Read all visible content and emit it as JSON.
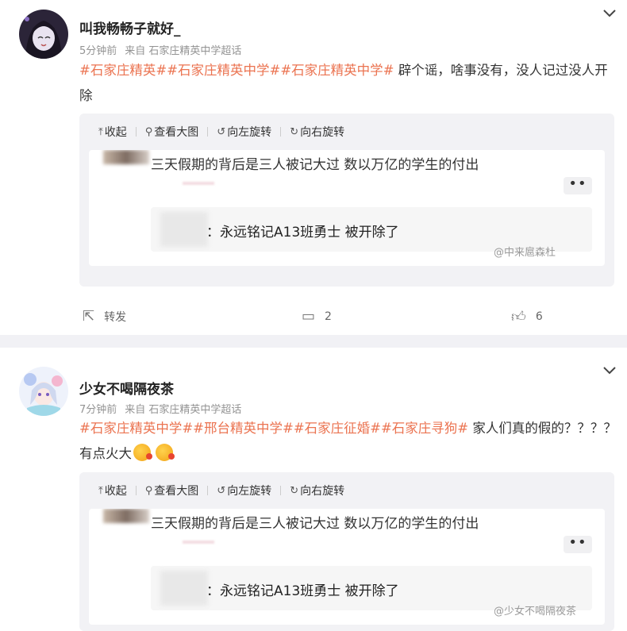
{
  "posts": [
    {
      "username": "叫我畅畅子就好_",
      "time": "5分钟前",
      "source": "来自 石家庄精英中学超话",
      "tags": [
        "#石家庄精英#",
        "#石家庄精英中学#",
        "#石家庄精英中学#"
      ],
      "body_text": "辟个谣，啥事没有，没人记过没人开除",
      "toolbar": {
        "collapse": "收起",
        "view_large": "查看大图",
        "rotate_left": "向左旋转",
        "rotate_right": "向右旋转"
      },
      "image": {
        "title": "三天假期的背后是三人被记大过 数以万亿的学生的付出",
        "line": "：永远铭记A13班勇士 被开除了",
        "watermark": "@中来扈森杜",
        "dots": "••"
      },
      "actions": {
        "repost": "转发",
        "comments": "2",
        "likes": "6"
      }
    },
    {
      "username": "少女不喝隔夜茶",
      "time": "7分钟前",
      "source": "来自 石家庄精英中学超话",
      "tags": [
        "#石家庄精英中学#",
        "#邢台精英中学#",
        "#石家庄征婚#",
        "#石家庄寻狗#"
      ],
      "body_text": "家人们真的假的？？？？",
      "body_text2": "有点火大",
      "toolbar": {
        "collapse": "收起",
        "view_large": "查看大图",
        "rotate_left": "向左旋转",
        "rotate_right": "向右旋转"
      },
      "image": {
        "title": "三天假期的背后是三人被记大过 数以万亿的学生的付出",
        "line": "：永远铭记A13班勇士 被开除了",
        "watermark": "@少女不喝隔夜茶",
        "dots": "••"
      }
    }
  ],
  "icons": {
    "chevron": "chevron-down-icon",
    "collapse": "arrow-up-icon",
    "zoom": "magnifier-icon",
    "rotate_left": "rotate-left-icon",
    "rotate_right": "rotate-right-icon",
    "repost": "share-icon",
    "comment": "comment-icon",
    "like": "thumbs-up-icon"
  },
  "colors": {
    "tag": "#eb7350",
    "meta": "#939393",
    "media_bg": "#f2f2f5"
  }
}
